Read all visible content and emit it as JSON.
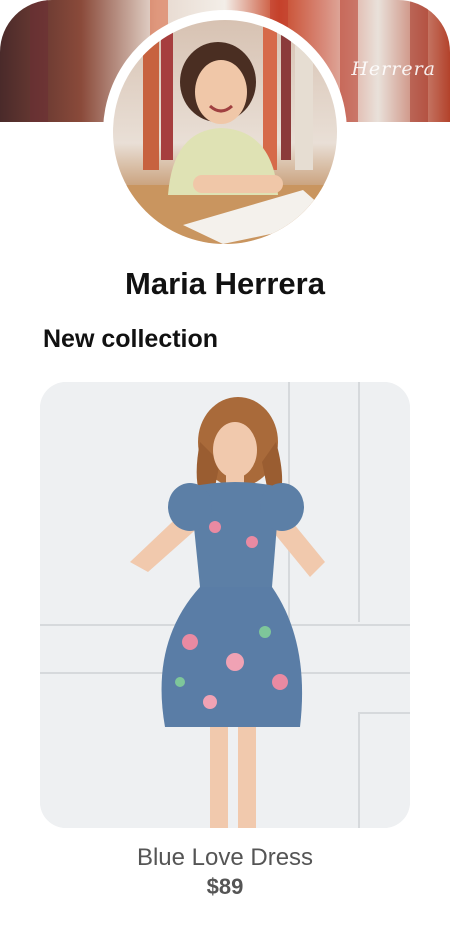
{
  "profile": {
    "cover_signature": "Herrera",
    "name": "Maria Herrera"
  },
  "section": {
    "title": "New collection"
  },
  "product": {
    "title": "Blue Love Dress",
    "price": "$89"
  }
}
